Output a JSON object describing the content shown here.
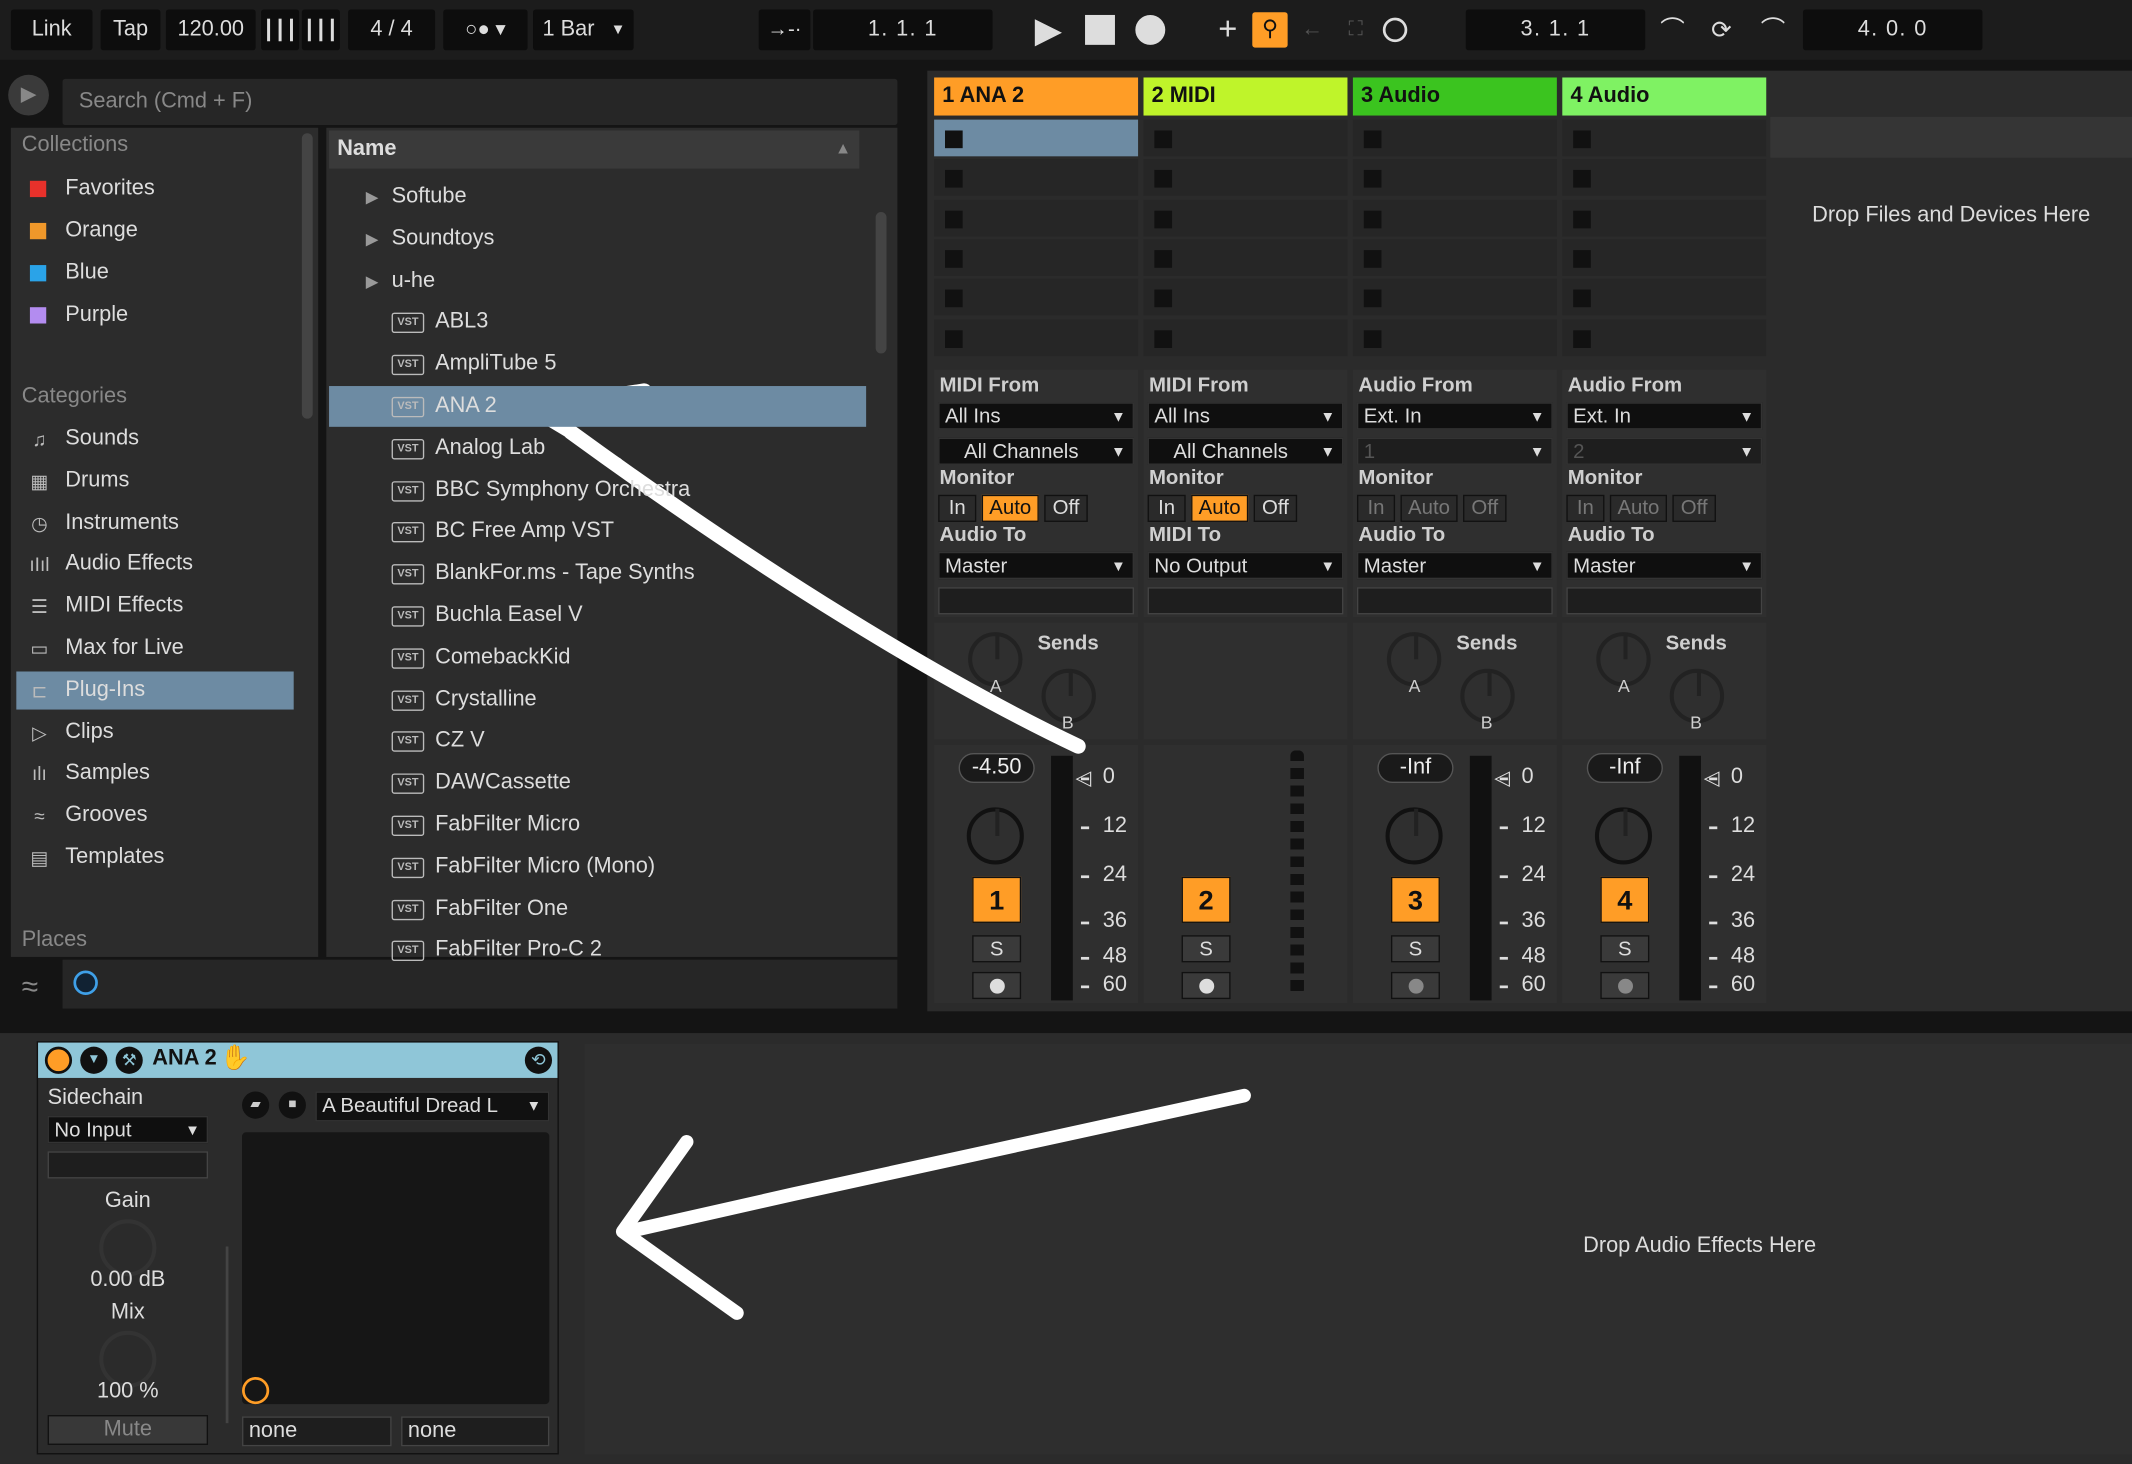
{
  "transport": {
    "link": "Link",
    "tap": "Tap",
    "tempo": "120.00",
    "meter": "4 / 4",
    "quantize": "1 Bar",
    "position": "1.   1.   1",
    "loop_start": "3.   1.   1",
    "loop_length": "4.   0.   0"
  },
  "browser": {
    "search_placeholder": "Search (Cmd + F)",
    "collections_header": "Collections",
    "collections": [
      {
        "label": "Favorites",
        "color": "#e8312b"
      },
      {
        "label": "Orange",
        "color": "#f0982a"
      },
      {
        "label": "Blue",
        "color": "#2aa3e8"
      },
      {
        "label": "Purple",
        "color": "#b38cf0"
      }
    ],
    "categories_header": "Categories",
    "categories": [
      {
        "label": "Sounds",
        "icon": "note-icon"
      },
      {
        "label": "Drums",
        "icon": "grid-icon"
      },
      {
        "label": "Instruments",
        "icon": "clock-icon"
      },
      {
        "label": "Audio Effects",
        "icon": "bars-icon"
      },
      {
        "label": "MIDI Effects",
        "icon": "lines-icon"
      },
      {
        "label": "Max for Live",
        "icon": "max-icon"
      },
      {
        "label": "Plug-Ins",
        "icon": "plug-icon"
      },
      {
        "label": "Clips",
        "icon": "clip-icon"
      },
      {
        "label": "Samples",
        "icon": "wave-icon"
      },
      {
        "label": "Grooves",
        "icon": "groove-icon"
      },
      {
        "label": "Templates",
        "icon": "template-icon"
      }
    ],
    "places_header": "Places",
    "name_header": "Name",
    "folders": [
      "Softube",
      "Soundtoys",
      "u-he"
    ],
    "plugins": [
      "ABL3",
      "AmpliTube 5",
      "ANA 2",
      "Analog Lab",
      "BBC Symphony Orchestra",
      "BC Free Amp VST",
      "BlankFor.ms - Tape Synths",
      "Buchla Easel V",
      "ComebackKid",
      "Crystalline",
      "CZ V",
      "DAWCassette",
      "FabFilter Micro",
      "FabFilter Micro (Mono)",
      "FabFilter One",
      "FabFilter Pro-C 2"
    ],
    "vst_badge": "VST"
  },
  "tracks": [
    {
      "title": "1 ANA 2",
      "color": "#ff9d26",
      "from_label": "MIDI From",
      "from": "All Ins",
      "chan": "All Channels",
      "to_label": "Audio To",
      "to": "Master",
      "vol": "-4.50",
      "num": "1"
    },
    {
      "title": "2 MIDI",
      "color": "#bff42a",
      "from_label": "MIDI From",
      "from": "All Ins",
      "chan": "All Channels",
      "to_label": "MIDI To",
      "to": "No Output",
      "vol": "",
      "num": "2"
    },
    {
      "title": "3 Audio",
      "color": "#3bc41f",
      "from_label": "Audio From",
      "from": "Ext. In",
      "chan": "1",
      "to_label": "Audio To",
      "to": "Master",
      "vol": "-Inf",
      "num": "3"
    },
    {
      "title": "4 Audio",
      "color": "#7ff263",
      "from_label": "Audio From",
      "from": "Ext. In",
      "chan": "2",
      "to_label": "Audio To",
      "to": "Master",
      "vol": "-Inf",
      "num": "4"
    }
  ],
  "mixer": {
    "monitor": "Monitor",
    "in": "In",
    "auto": "Auto",
    "off": "Off",
    "sends": "Sends",
    "send_a": "A",
    "send_b": "B",
    "solo": "S",
    "scale": [
      "0",
      "12",
      "24",
      "36",
      "48",
      "60"
    ]
  },
  "drop_files": "Drop Files and Devices Here",
  "drop_effects": "Drop Audio Effects Here",
  "device": {
    "title": "ANA 2",
    "sidechain": "Sidechain",
    "sidechain_value": "No Input",
    "gain_label": "Gain",
    "gain_value": "0.00 dB",
    "mix_label": "Mix",
    "mix_value": "100 %",
    "mute": "Mute",
    "preset": "A Beautiful Dread L",
    "macro_a": "none",
    "macro_b": "none"
  },
  "colors": {
    "accent": "#ff9d26",
    "selection": "#6d8ba3",
    "device_header": "#8fc6d8"
  }
}
